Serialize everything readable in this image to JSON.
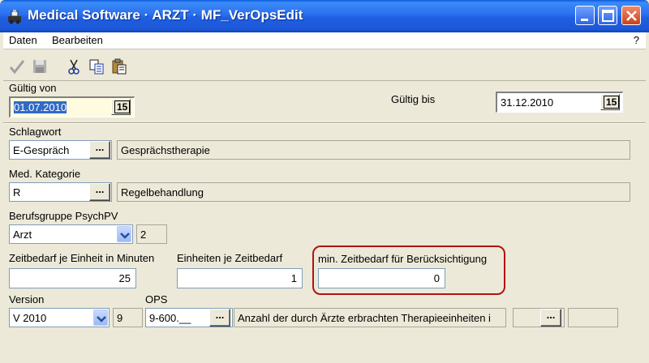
{
  "window": {
    "title": "Medical Software · ARZT · MF_VerOpsEdit",
    "icon": "app-icon",
    "controls": [
      "minimize-icon",
      "maximize-icon",
      "close-icon"
    ]
  },
  "menu": {
    "items": [
      "Daten",
      "Bearbeiten"
    ],
    "help": "?"
  },
  "toolbar": {
    "icons": [
      "checkmark-icon",
      "save-icon",
      "cut-icon",
      "copy-icon",
      "paste-icon"
    ]
  },
  "gueltig_von": {
    "label": "Gültig von",
    "value": "01.07.2010",
    "cal_label": "15"
  },
  "gueltig_bis": {
    "label": "Gültig bis",
    "value": "31.12.2010",
    "cal_label": "15"
  },
  "schlagwort": {
    "label": "Schlagwort",
    "code": "E-Gespräch",
    "button": "...",
    "description": "Gesprächstherapie"
  },
  "kategorie": {
    "label": "Med. Kategorie",
    "code": "R",
    "button": "...",
    "description": "Regelbehandlung"
  },
  "berufsgruppe": {
    "label": "Berufsgruppe PsychPV",
    "selected": "Arzt",
    "code": "2"
  },
  "zeitbedarf": {
    "label": "Zeitbedarf je Einheit in Minuten",
    "value": "25"
  },
  "einheiten": {
    "label": "Einheiten je Zeitbedarf",
    "value": "1"
  },
  "min_zeitbedarf": {
    "label": "min. Zeitbedarf für Berücksichtigung",
    "value": "0",
    "highlight_color": "#b01414"
  },
  "version": {
    "label": "Version",
    "selected": "V 2010",
    "code": "9"
  },
  "ops": {
    "label": "OPS",
    "code": "9-600.__",
    "button": "...",
    "description": "Anzahl der durch Ärzte erbrachten Therapieeinheiten i",
    "extra_button": "..."
  },
  "colors": {
    "titlebar": "#1f5fe0",
    "window_bg": "#ece9d8",
    "selection": "#316ac5"
  }
}
